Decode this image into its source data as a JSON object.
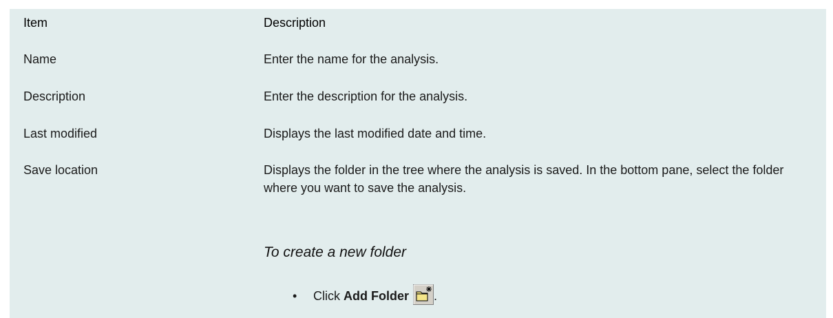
{
  "header": {
    "item": "Item",
    "description": "Description"
  },
  "rows": [
    {
      "item": "Name",
      "description": "Enter the name for the analysis."
    },
    {
      "item": "Description",
      "description": "Enter the description for the analysis."
    },
    {
      "item": "Last modified",
      "description": "Displays the last modified date and time."
    },
    {
      "item": "Save location",
      "description": "Displays the folder in the tree where the analysis is saved. In the bottom pane, select the folder where you want to save the analysis."
    }
  ],
  "procedure": {
    "title": "To create a new folder",
    "bullet": "•",
    "step_prefix": "Click",
    "step_button": "Add Folder",
    "step_suffix": ".",
    "icon": "new-folder-icon"
  }
}
